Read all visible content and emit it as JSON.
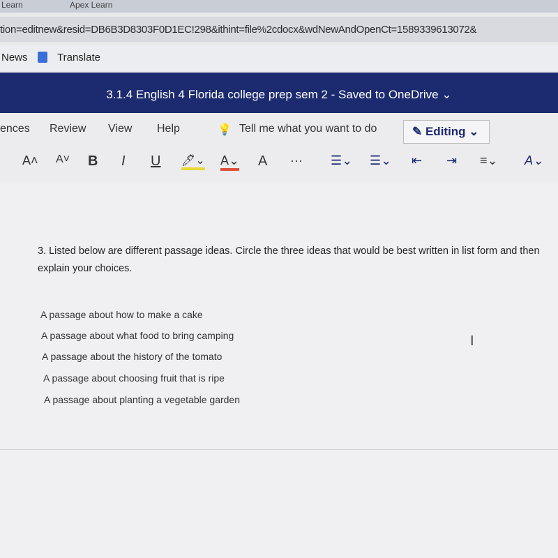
{
  "browser": {
    "tabs": [
      "Learn",
      "Apex Learn"
    ],
    "url": "tion=editnew&resid=DB6B3D8303F0D1EC!298&ithint=file%2cdocx&wdNewAndOpenCt=1589339613072&",
    "bookmarks": [
      "News",
      "Translate"
    ]
  },
  "titlebar": {
    "title": "3.1.4 English 4 Florida college prep sem 2 - Saved to OneDrive ⌄"
  },
  "ribbon": {
    "menus": [
      "ences",
      "Review",
      "View",
      "Help"
    ],
    "tell_me": "Tell me what you want to do",
    "editing": "Editing ⌄",
    "tools": [
      "A˄",
      "A˅",
      "B",
      "I",
      "U",
      "🖊⌄",
      "A⌄",
      "A",
      "···",
      "☰⌄",
      "☰⌄",
      "⇤",
      "⇥",
      "≡⌄",
      "A⌄"
    ]
  },
  "document": {
    "question": "3. Listed below are different passage ideas. Circle the three ideas that would be best written in list form and then explain your choices.",
    "items": [
      "A passage about how to make a cake",
      "A passage about what food to bring camping",
      "A passage about the history of the tomato",
      "A passage about choosing fruit that is ripe",
      "A passage about planting a vegetable garden"
    ]
  },
  "colors": {
    "titlebar": "#1c2a6f",
    "highlight": "#e8d838",
    "font_color": "#e0503a"
  }
}
